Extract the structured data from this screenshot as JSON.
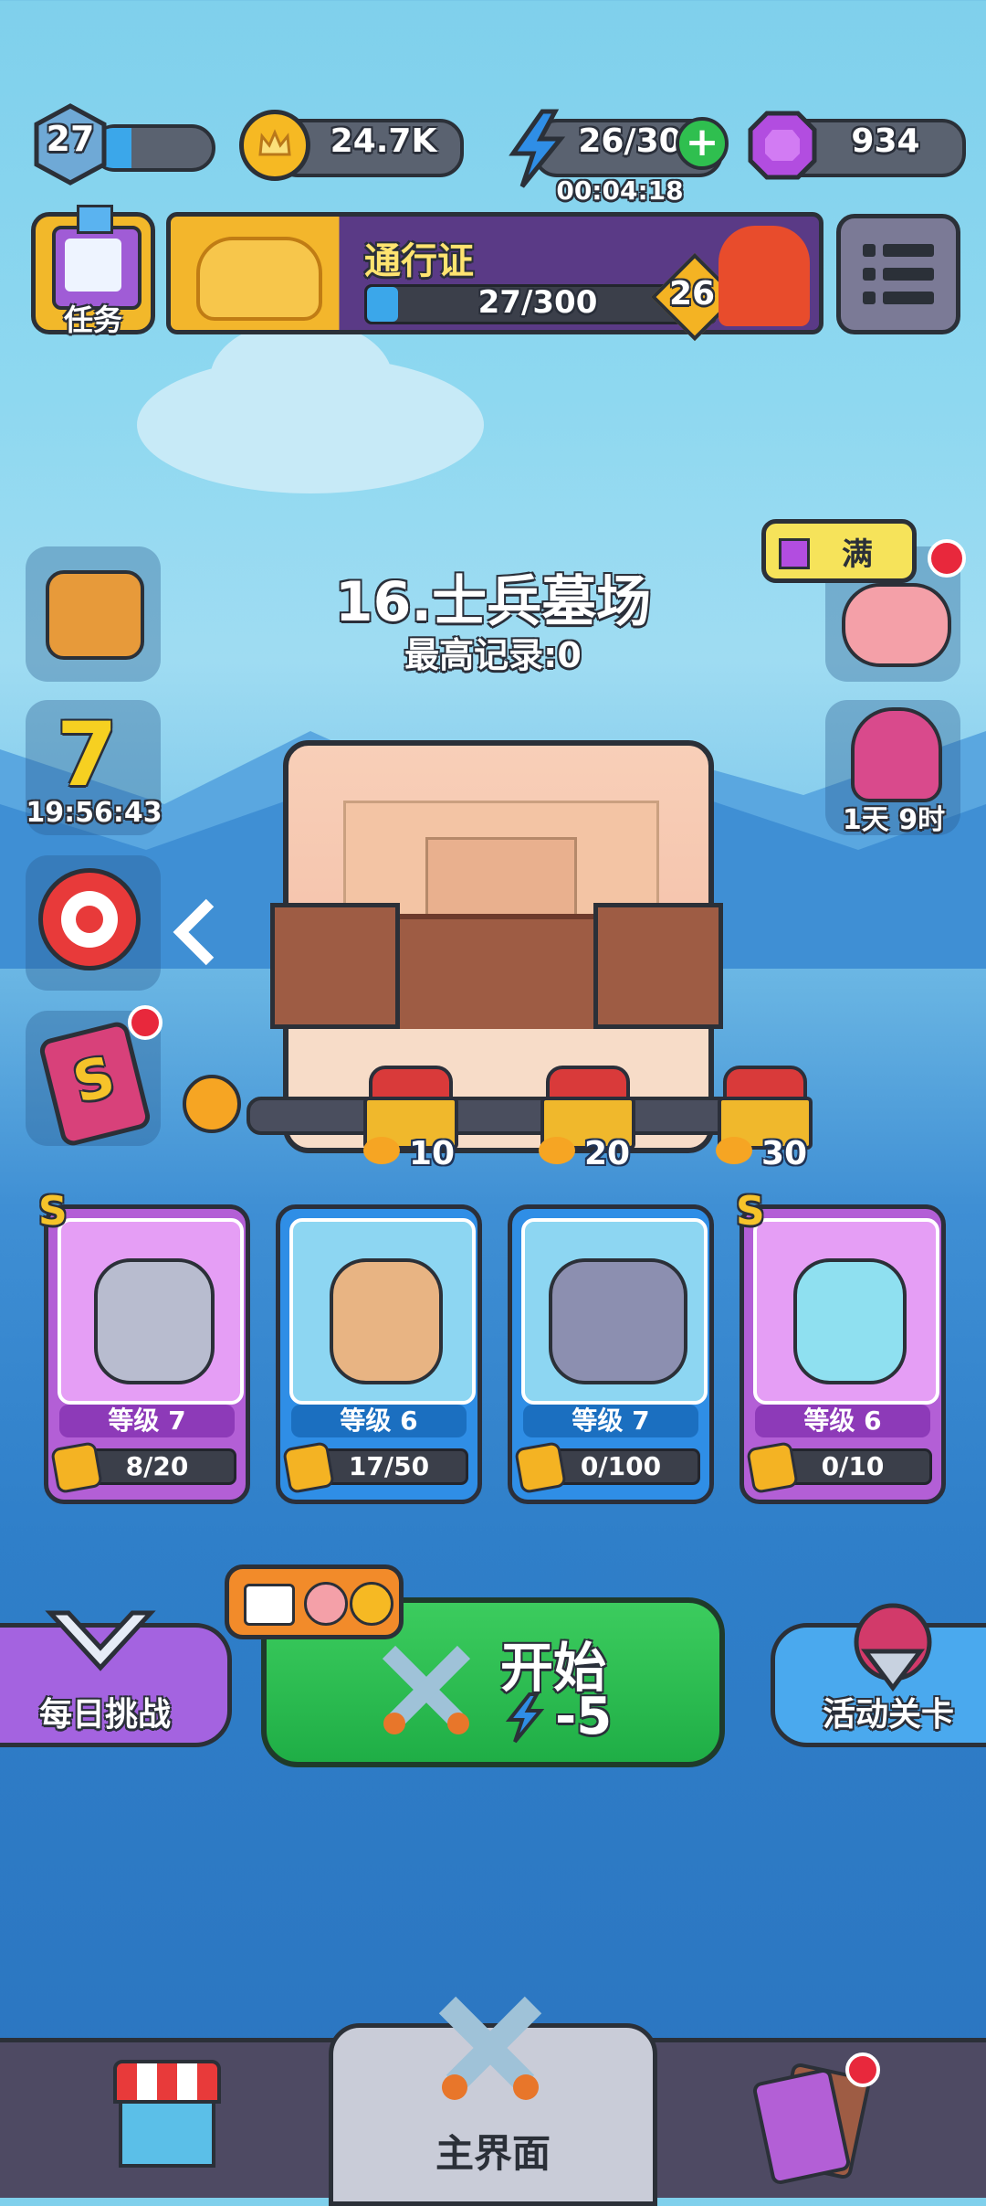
{
  "top_bar": {
    "player_level": "27",
    "coins": "24.7K",
    "energy": "26/30",
    "energy_timer": "00:04:18",
    "gems": "934"
  },
  "quests_label": "任务",
  "battle_pass": {
    "title": "通行证",
    "progress_text": "27/300",
    "progress_fraction": 0.09,
    "level": "26"
  },
  "stage": {
    "name": "16.士兵墓场",
    "best_record": "最高记录:0"
  },
  "side_left": {
    "event_timer": "19:56:43"
  },
  "side_right": {
    "piggy_label": "满",
    "event_timer": "1天 9时"
  },
  "chests": [
    {
      "label": "10"
    },
    {
      "label": "20"
    },
    {
      "label": "30"
    }
  ],
  "heroes": [
    {
      "rank": "S",
      "level": "等级 7",
      "progress": "8/20",
      "color": "#c76ee6"
    },
    {
      "rank": "",
      "level": "等级 6",
      "progress": "17/50",
      "color": "#3aa0e8"
    },
    {
      "rank": "",
      "level": "等级 7",
      "progress": "0/100",
      "color": "#3aa0e8"
    },
    {
      "rank": "S",
      "level": "等级 6",
      "progress": "0/10",
      "color": "#c76ee6"
    }
  ],
  "actions": {
    "daily_challenge": "每日挑战",
    "start": "开始",
    "start_cost": "-5",
    "event_stage": "活动关卡"
  },
  "bottom_nav": {
    "main_label": "主界面"
  },
  "colors": {
    "start_green": "#21b54a",
    "purple_btn": "#a463e0",
    "blue_btn": "#4aa9ee"
  }
}
